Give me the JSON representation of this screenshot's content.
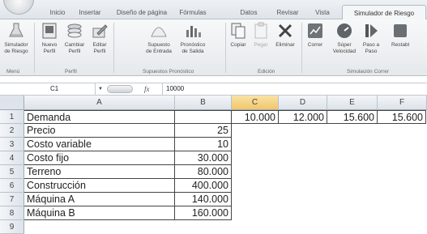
{
  "ribbon": {
    "tabs": [
      "Inicio",
      "Insertar",
      "Diseño de página",
      "Fórmulas",
      "Datos",
      "Revisar",
      "Vista",
      "Simulador de Riesgo"
    ],
    "buttons": [
      {
        "line1": "Simulador",
        "line2": "de Riesgo",
        "dim": false
      },
      {
        "line1": "Nuevo",
        "line2": "Perfil",
        "dim": false
      },
      {
        "line1": "Cambiar",
        "line2": "Perfil",
        "dim": false
      },
      {
        "line1": "Editar",
        "line2": "Perfil",
        "dim": false
      },
      {
        "line1": "Supuesto",
        "line2": "de Entrada",
        "dim": false
      },
      {
        "line1": "Pronóstico",
        "line2": "de Salida",
        "dim": false
      },
      {
        "line1": "Copiar",
        "line2": "",
        "dim": false
      },
      {
        "line1": "Pegar",
        "line2": "",
        "dim": true
      },
      {
        "line1": "Eliminar",
        "line2": "",
        "dim": false
      },
      {
        "line1": "Correr",
        "line2": "",
        "dim": false
      },
      {
        "line1": "Súper",
        "line2": "Velocidad",
        "dim": false
      },
      {
        "line1": "Paso a",
        "line2": "Paso",
        "dim": false
      },
      {
        "line1": "Restabl",
        "line2": "",
        "dim": false
      }
    ],
    "groups": [
      "Menú",
      "Perfil",
      "Supuestos Pronóstico",
      "Edición",
      "Simulación Correr"
    ]
  },
  "formula_bar": {
    "name_box": "C1",
    "fx": "fx",
    "value": "10000"
  },
  "grid": {
    "columns": [
      "A",
      "B",
      "C",
      "D",
      "E",
      "F"
    ],
    "rows": [
      {
        "num": "1",
        "label": "Demanda",
        "value": "",
        "c": "10.000",
        "d": "12.000",
        "e": "15.600",
        "f": "15.600"
      },
      {
        "num": "2",
        "label": "Precio",
        "value": "25"
      },
      {
        "num": "3",
        "label": "Costo variable",
        "value": "10"
      },
      {
        "num": "4",
        "label": "Costo fijo",
        "value": "30.000"
      },
      {
        "num": "5",
        "label": "Terreno",
        "value": "80.000"
      },
      {
        "num": "6",
        "label": "Construcción",
        "value": "400.000"
      },
      {
        "num": "7",
        "label": "Máquina A",
        "value": "140.000"
      },
      {
        "num": "8",
        "label": "Máquina B",
        "value": "160.000"
      },
      {
        "num": "9",
        "label": "",
        "value": ""
      }
    ]
  },
  "colors": {
    "ribbon_bg": "#eef1f4",
    "selected_header": "#f2c769",
    "cell_border": "#444444"
  }
}
